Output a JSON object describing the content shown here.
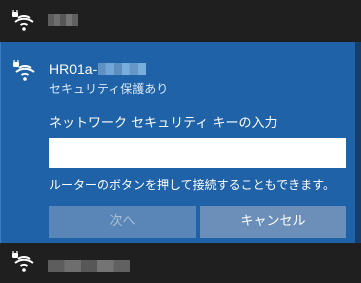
{
  "top_network": {
    "icon": "wifi-secured-icon"
  },
  "selected_network": {
    "icon": "wifi-secured-icon",
    "name": "HR01a-",
    "status": "セキュリティ保護あり",
    "prompt_label": "ネットワーク セキュリティ キーの入力",
    "security_key_value": "",
    "hint": "ルーターのボタンを押して接続することもできます。",
    "next_button": "次へ",
    "cancel_button": "キャンセル"
  },
  "bottom_network": {
    "icon": "wifi-secured-icon"
  },
  "colors": {
    "panel_background": "#1f62a8",
    "page_background": "#1f1f1f",
    "disabled_button": "#5a86b7",
    "cancel_button": "#6b8fb8"
  }
}
